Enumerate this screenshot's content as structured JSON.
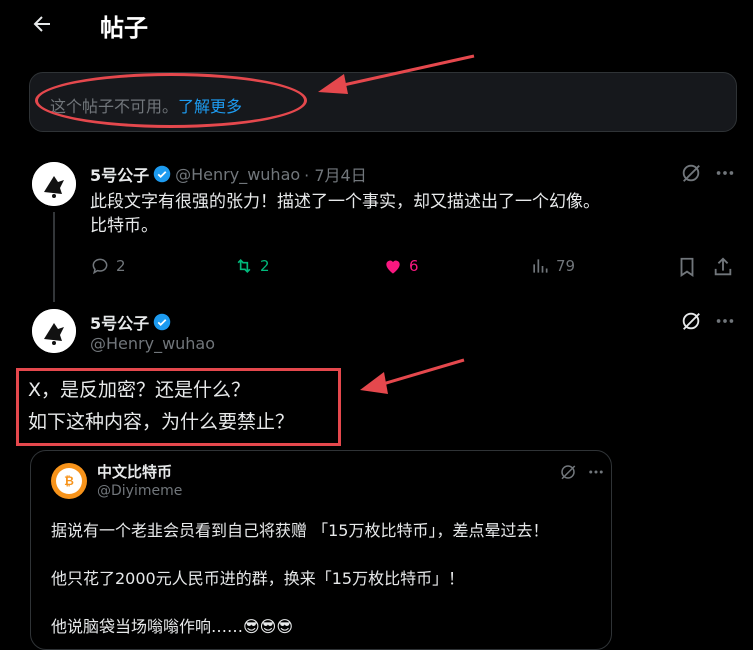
{
  "header": {
    "title": "帖子"
  },
  "notice": {
    "text": "这个帖子不可用。",
    "link": "了解更多"
  },
  "reply_post": {
    "name": "5号公子",
    "handle": "@Henry_wuhao",
    "date": "· 7月4日",
    "lines": [
      "此段文字有很强的张力！描述了一个事实，却又描述出了一个幻像。",
      "比特币。"
    ],
    "replies": "2",
    "reposts": "2",
    "likes": "6",
    "views": "79"
  },
  "main_post": {
    "name": "5号公子",
    "handle": "@Henry_wuhao",
    "lines": [
      "X，是反加密？还是什么？",
      "如下这种内容，为什么要禁止？"
    ]
  },
  "quoted_post": {
    "name": "中文比特币",
    "handle": "@Diyimeme",
    "avatar_text": "比特币",
    "lines": [
      "据说有一个老韭会员看到自己将获赠 「15万枚比特币」，差点晕过去！",
      "他只花了2000元人民币进的群，换来「15万枚比特币」！",
      "他说脑袋当场嗡嗡作响……😎😎😎"
    ]
  },
  "colors": {
    "accent": "#1d9bf0",
    "repost": "#00ba7c",
    "like": "#f91880",
    "annotation": "#e5484d"
  }
}
